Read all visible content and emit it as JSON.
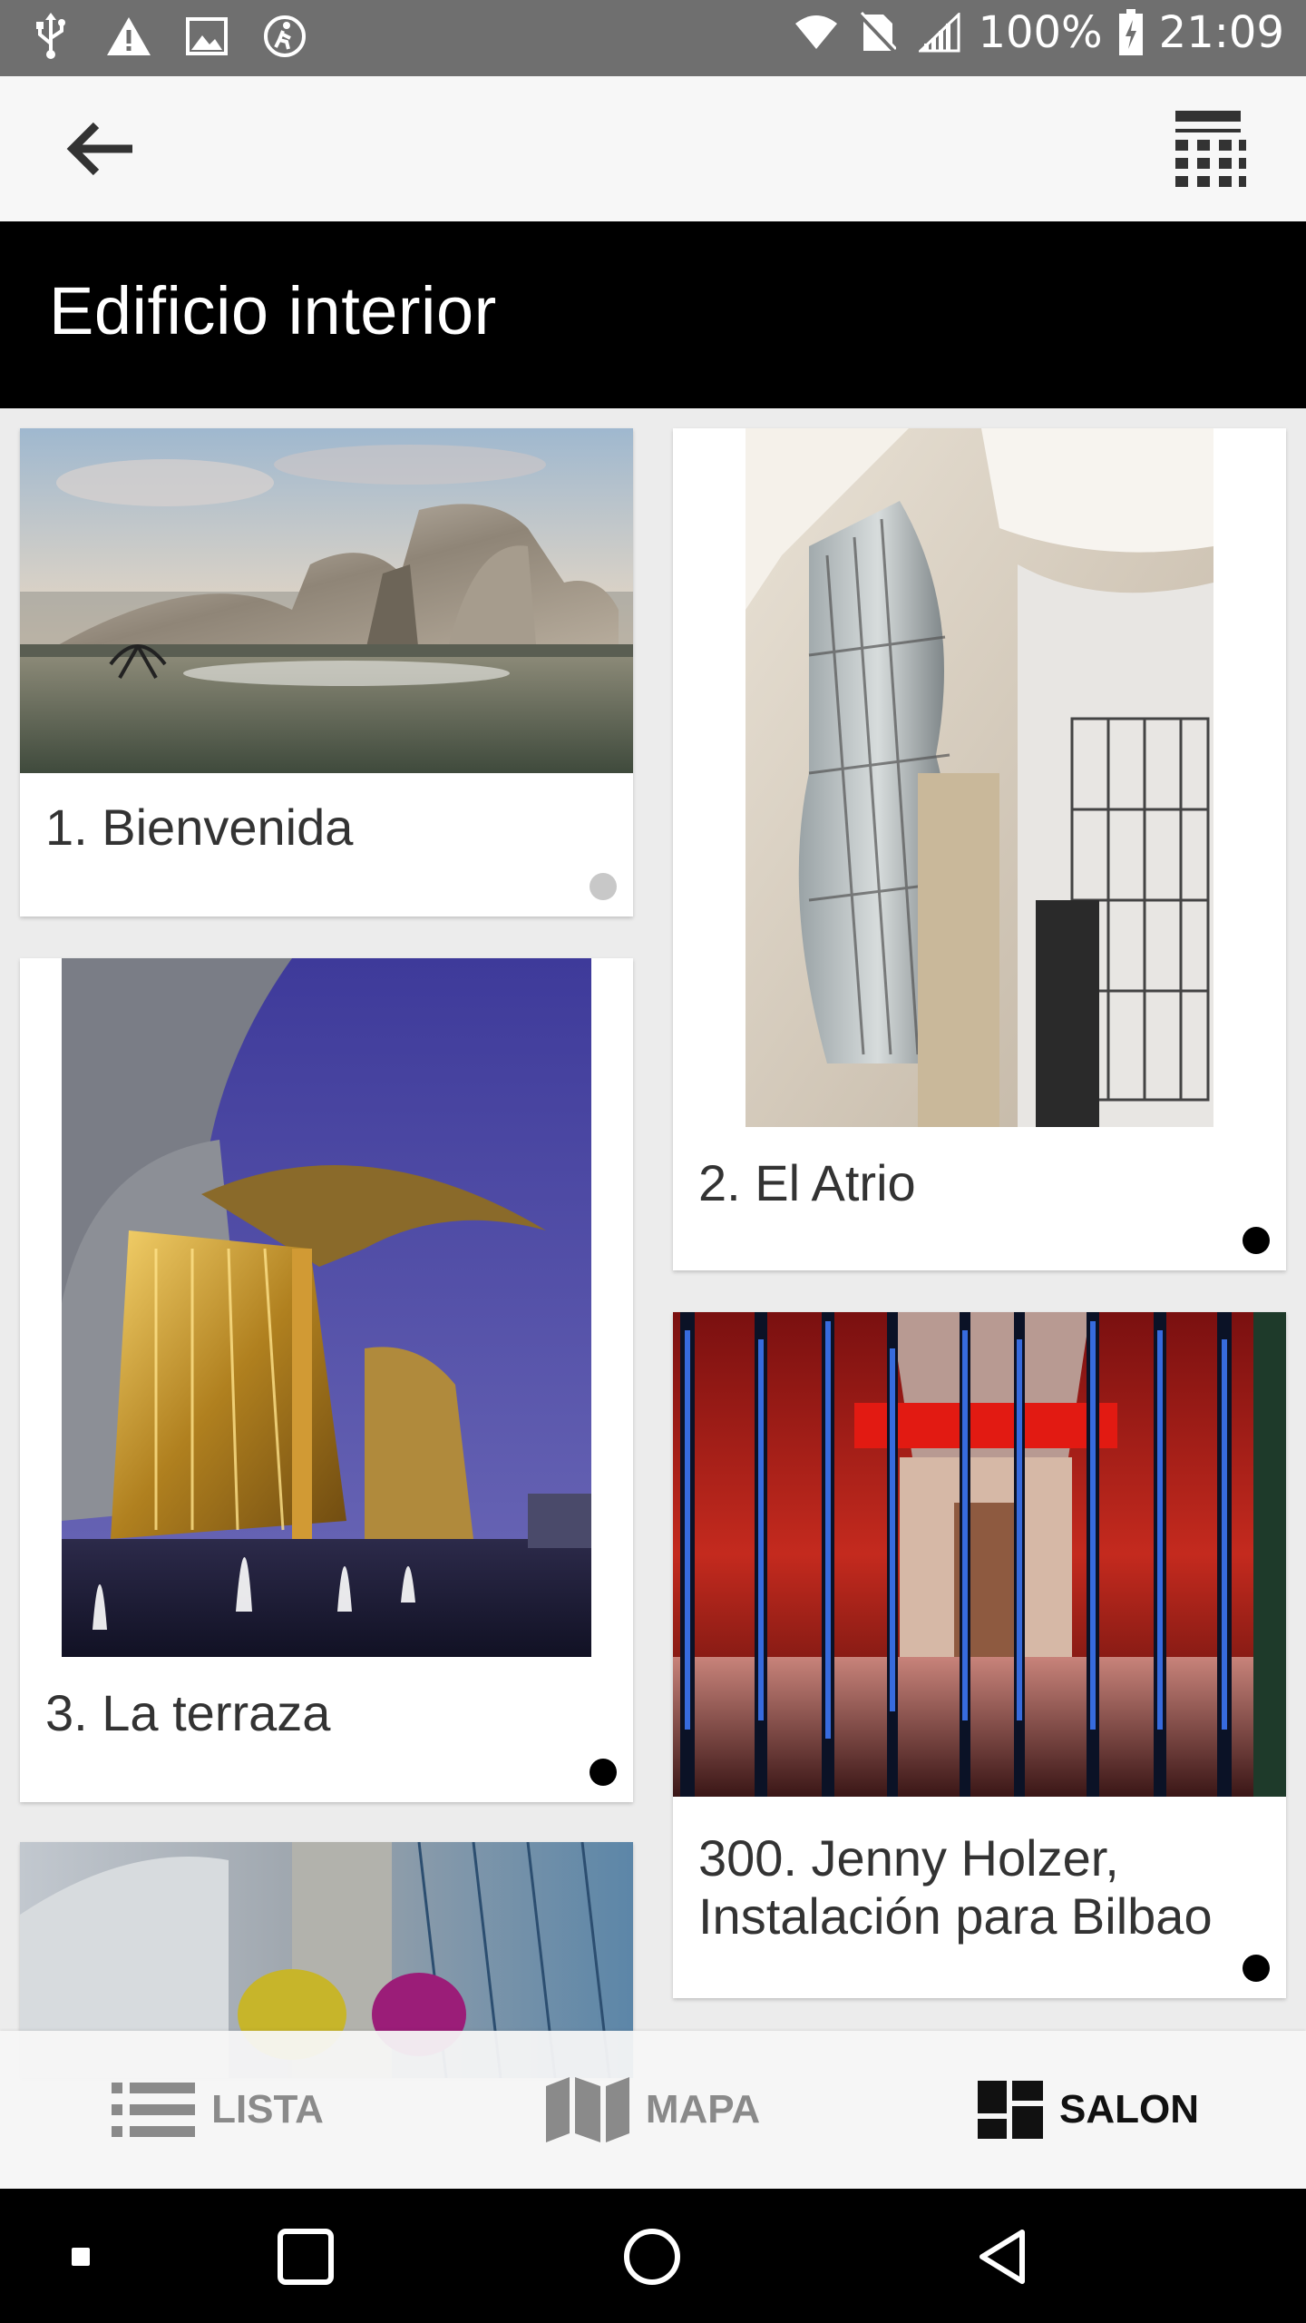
{
  "status_bar": {
    "battery": "100%",
    "time": "21:09",
    "left_icons": [
      "usb-icon",
      "warning-icon",
      "image-icon",
      "accessibility-icon"
    ],
    "right_icons": [
      "wifi-icon",
      "no-sim-icon",
      "signal-icon",
      "battery-icon"
    ]
  },
  "toolbar": {
    "back_icon": "arrow-left-icon",
    "keypad_icon": "keypad-icon"
  },
  "header": {
    "title": "Edificio interior"
  },
  "cards": [
    {
      "label": "1. Bienvenida",
      "visited": false
    },
    {
      "label": "2. El Atrio",
      "visited": true
    },
    {
      "label": "3. La terraza",
      "visited": true
    },
    {
      "label": "300. Jenny Holzer, Instalación para Bilbao",
      "visited": true
    }
  ],
  "colors": {
    "dot_unvisited": "#c8c8c8",
    "dot_visited": "#000000",
    "title_background": "#000000",
    "status_bar": "#6f6f6f"
  },
  "bottom_nav": {
    "items": [
      {
        "label": "LISTA",
        "icon": "list-icon",
        "active": false
      },
      {
        "label": "MAPA",
        "icon": "map-icon",
        "active": false
      },
      {
        "label": "SALON",
        "icon": "dashboard-icon",
        "active": true
      }
    ]
  },
  "system_nav": {
    "buttons": [
      "recents-small-icon",
      "overview-square-icon",
      "home-circle-icon",
      "back-triangle-icon"
    ]
  }
}
